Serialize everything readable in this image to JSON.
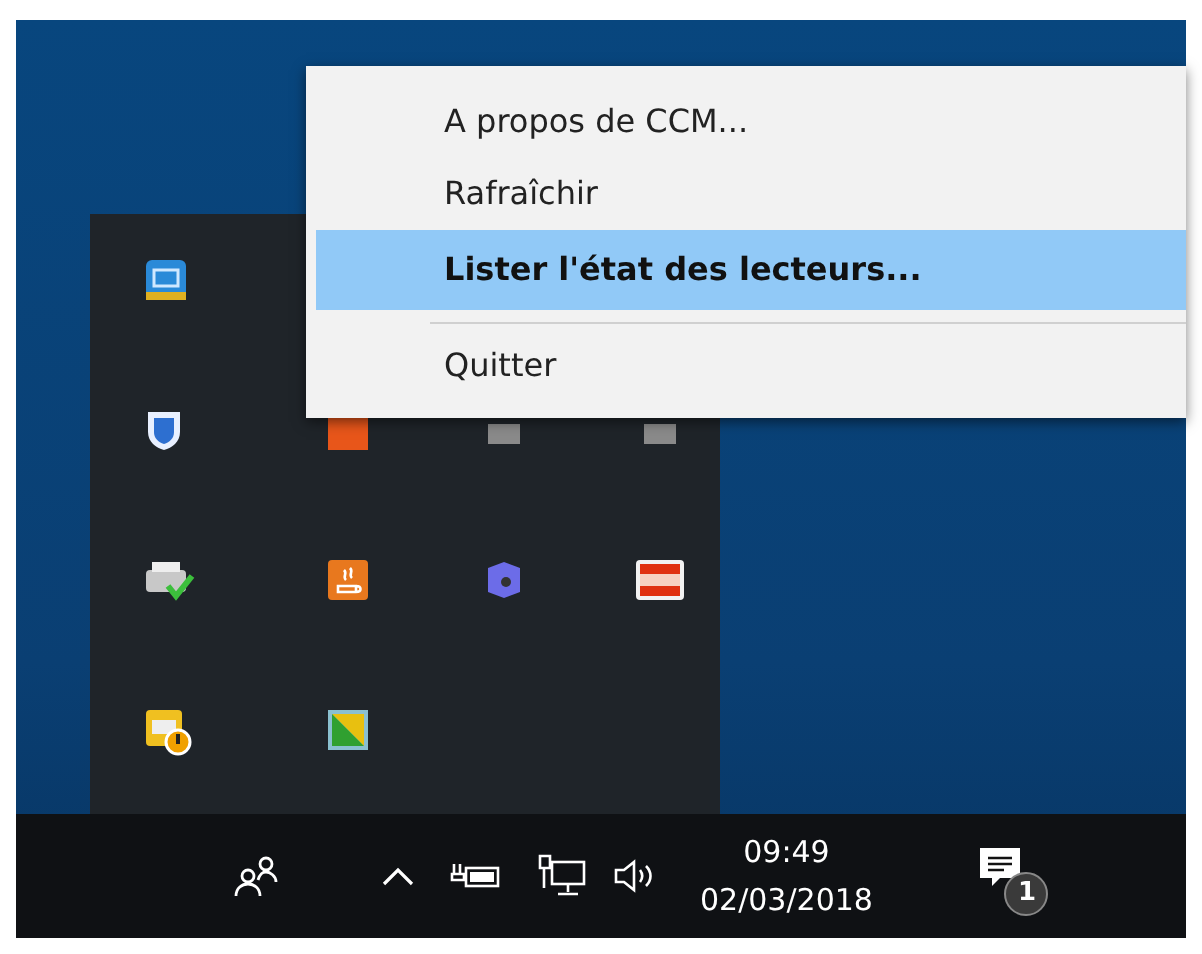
{
  "context_menu": {
    "items": [
      {
        "label": "A propos de CCM...",
        "selected": false,
        "separator_before": false
      },
      {
        "label": "Rafraîchir",
        "selected": false,
        "separator_before": false
      },
      {
        "label": "Lister l'état des lecteurs...",
        "selected": true,
        "separator_before": false
      },
      {
        "label": "Quitter",
        "selected": false,
        "separator_before": true
      }
    ]
  },
  "taskbar": {
    "time": "09:49",
    "date": "02/03/2018",
    "notification_count": "1"
  }
}
